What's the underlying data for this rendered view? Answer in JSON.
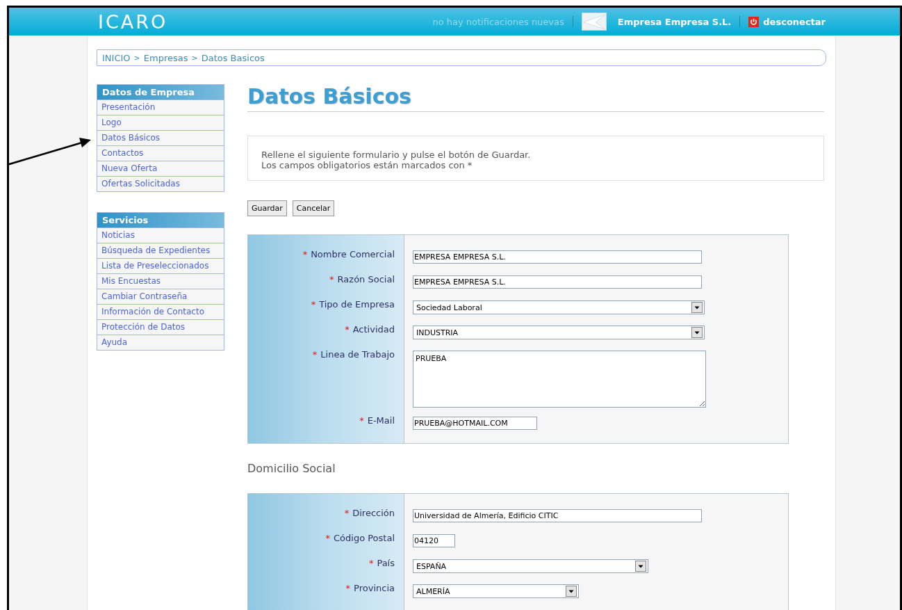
{
  "header": {
    "logo": "ICARO",
    "notifications": "no hay notificaciones nuevas",
    "company": "Empresa Empresa S.L.",
    "logout": "desconectar"
  },
  "breadcrumb": [
    "INICIO",
    ">",
    "Empresas",
    ">",
    "Datos Basicos"
  ],
  "sidebar": [
    {
      "title": "Datos de Empresa",
      "items": [
        {
          "label": "Presentación"
        },
        {
          "label": "Logo"
        },
        {
          "label": "Datos Básicos"
        },
        {
          "label": "Contactos"
        },
        {
          "label": "Nueva Oferta"
        },
        {
          "label": "Ofertas Solicitadas"
        }
      ]
    },
    {
      "title": "Servicios",
      "items": [
        {
          "label": "Noticias"
        },
        {
          "label": "Búsqueda de Expedientes"
        },
        {
          "label": "Lista de Preseleccionados"
        },
        {
          "label": "Mis Encuestas"
        },
        {
          "label": "Cambiar Contraseña"
        },
        {
          "label": "Información de Contacto"
        },
        {
          "label": "Protección de Datos"
        },
        {
          "label": "Ayuda"
        }
      ]
    }
  ],
  "page_title": "Datos Básicos",
  "notice": [
    "Rellene el siguiente formulario y pulse el botón de Guardar.",
    "Los campos obligatorios están marcados con *"
  ],
  "buttons": [
    "Guardar",
    "Cancelar"
  ],
  "sections": [
    {
      "fields": [
        {
          "kind": "text",
          "label": "Nombre Comercial",
          "required": "*",
          "value": "EMPRESA EMPRESA S.L."
        },
        {
          "kind": "text",
          "label": "Razón Social",
          "required": "*",
          "value": "EMPRESA EMPRESA S.L."
        },
        {
          "kind": "select",
          "label": "Tipo de Empresa",
          "required": "*",
          "value": "Sociedad Laboral"
        },
        {
          "kind": "select",
          "label": "Actividad",
          "required": "*",
          "value": "INDUSTRIA"
        },
        {
          "kind": "textarea",
          "label": "Linea de Trabajo",
          "required": "*",
          "value": "PRUEBA"
        },
        {
          "kind": "short",
          "label": "E-Mail",
          "required": "*",
          "value": "PRUEBA@HOTMAIL.COM"
        }
      ]
    },
    {
      "title": "Domicilio Social",
      "fields": [
        {
          "kind": "text",
          "label": "Dirección",
          "required": "*",
          "value": "Universidad de Almería, Edificio CITIC"
        },
        {
          "kind": "tiny",
          "label": "Código Postal",
          "required": "*",
          "value": "04120"
        },
        {
          "kind": "select-medium",
          "label": "País",
          "required": "*",
          "value": "ESPAÑA"
        },
        {
          "kind": "select-small",
          "label": "Provincia",
          "required": "*",
          "value": "ALMERÍA"
        }
      ]
    }
  ]
}
